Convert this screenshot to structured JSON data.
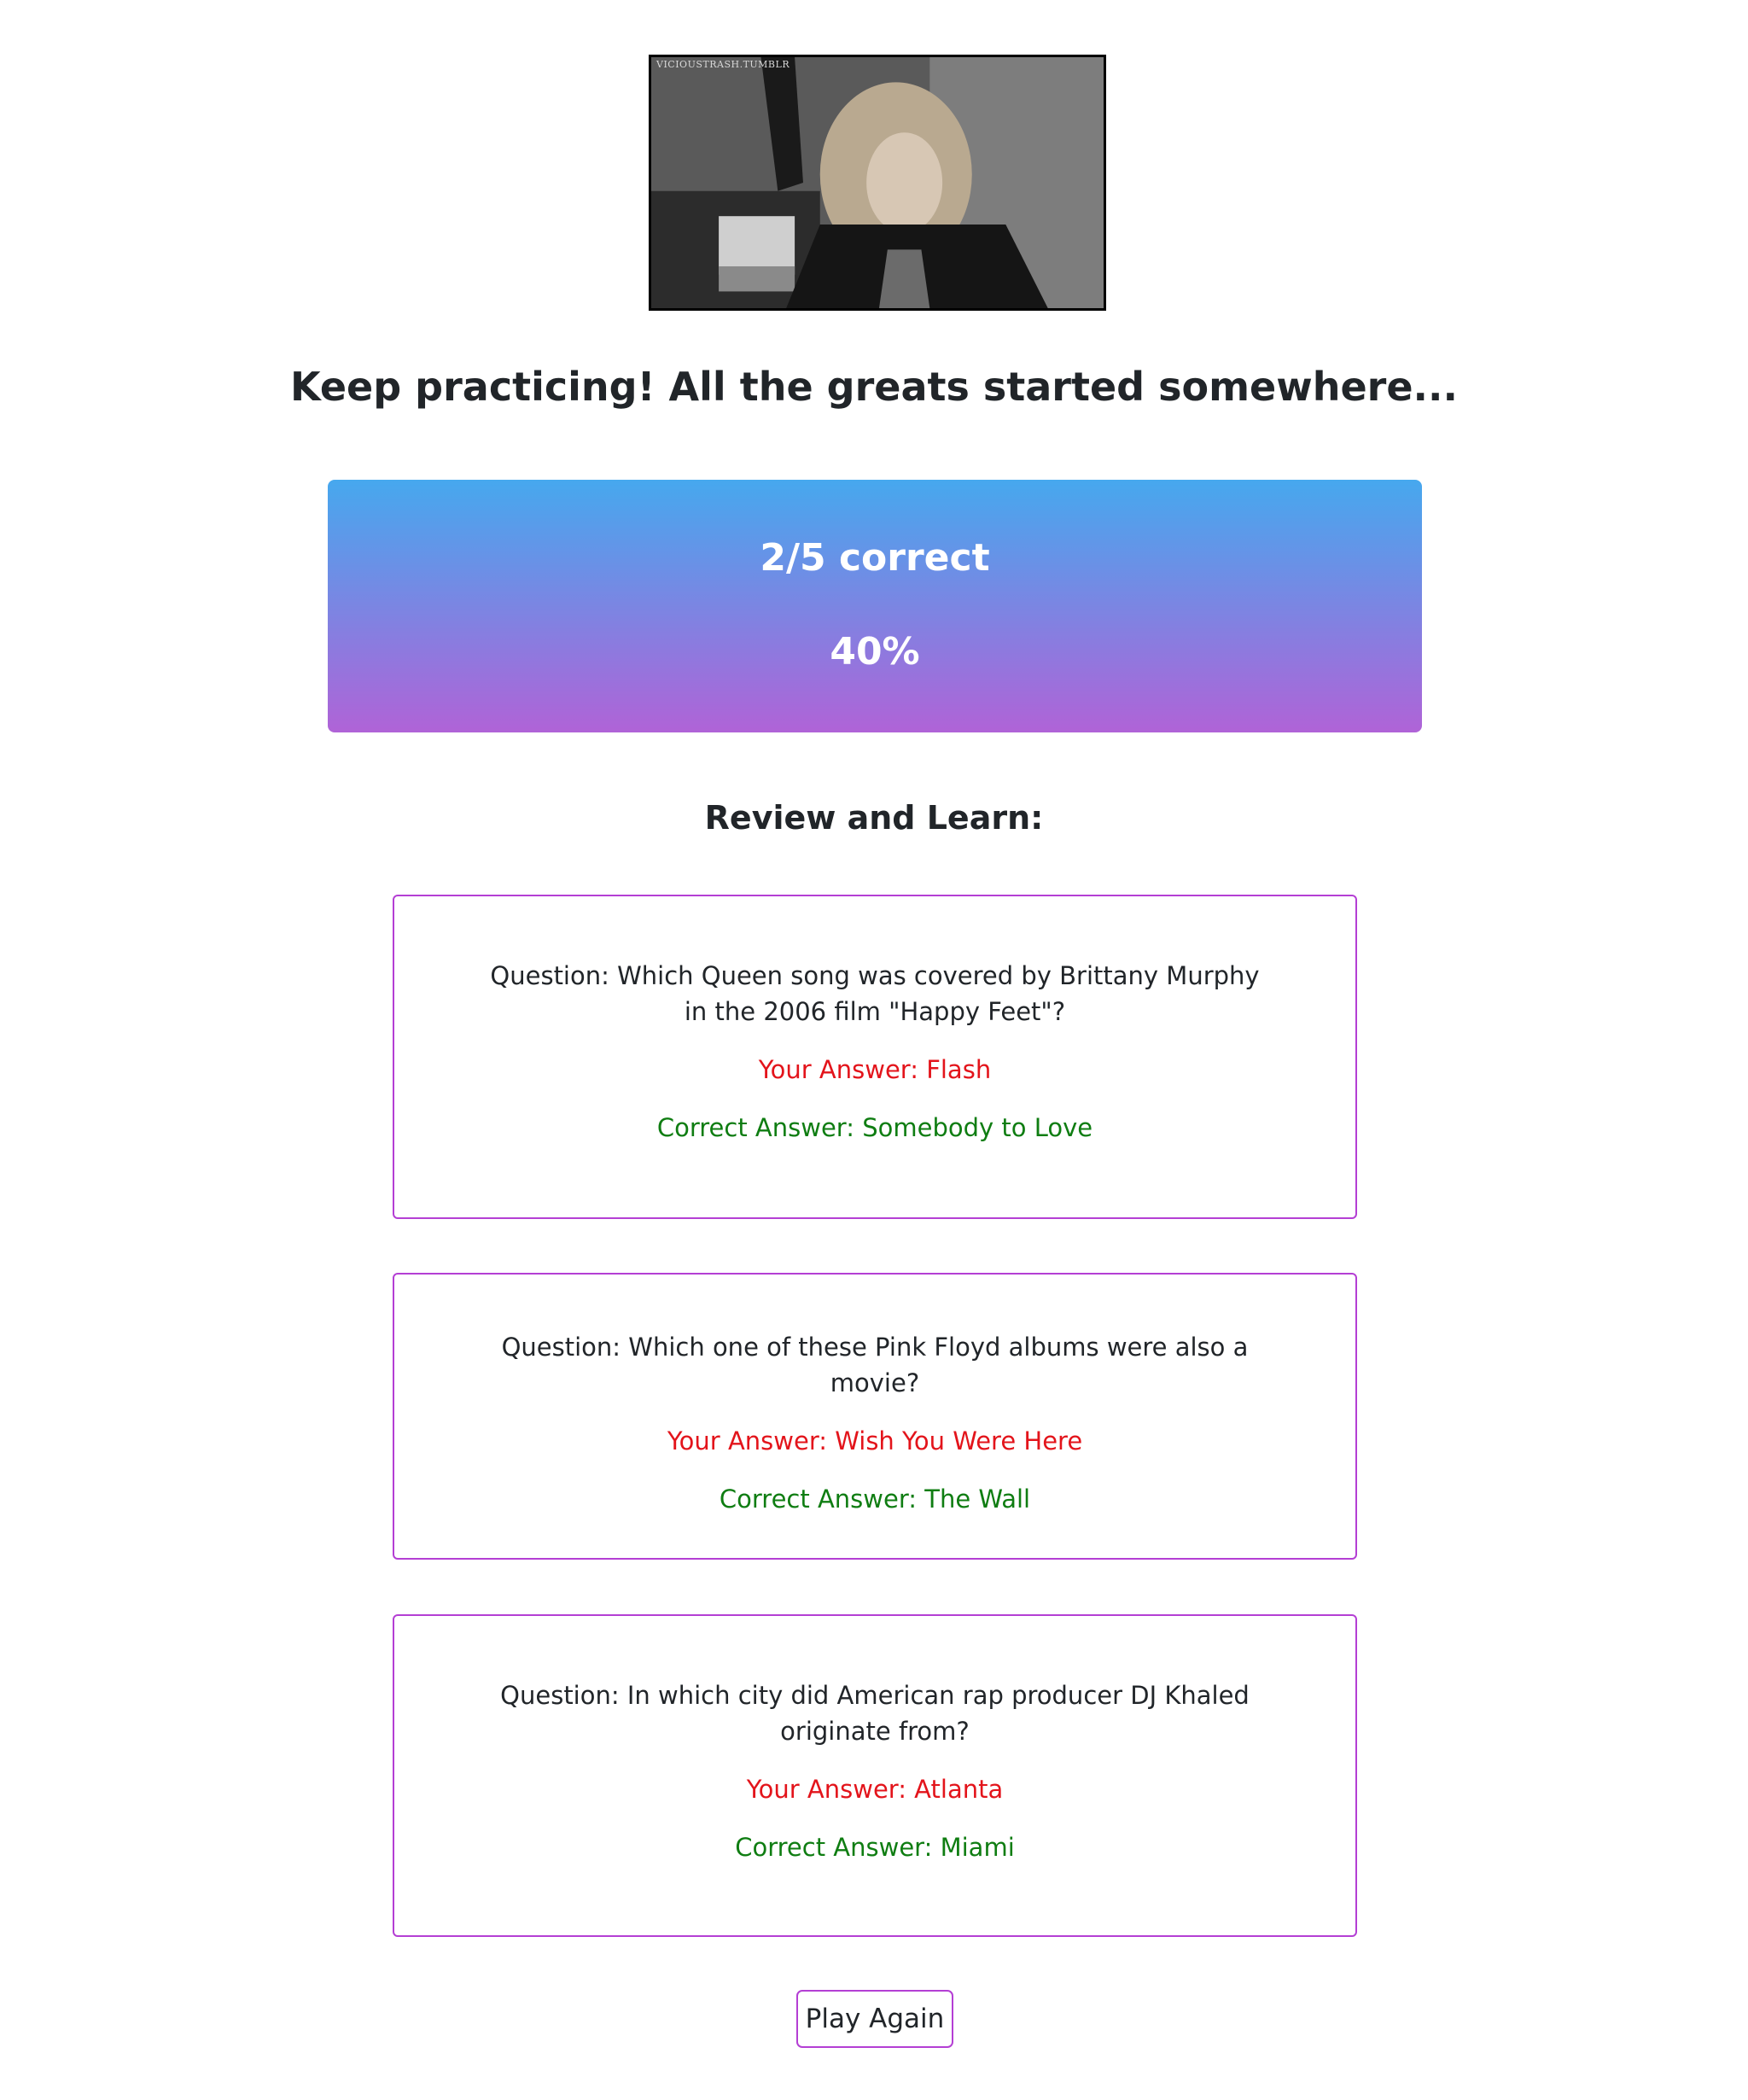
{
  "result_image": {
    "watermark": "VICIOUSTRASH.TUMBLR",
    "description_icon": "animated-gif"
  },
  "headline": "Keep practicing! All the greats started somewhere...",
  "score": {
    "fraction_label": "2/5 correct",
    "percent_label": "40%",
    "correct": 2,
    "total": 5,
    "percent": 40
  },
  "review": {
    "heading": "Review and Learn:",
    "items": [
      {
        "question": "Question: Which Queen song was covered by Brittany Murphy in the 2006 film \"Happy Feet\"?",
        "your_answer": "Your Answer: Flash",
        "correct_answer": "Correct Answer: Somebody to Love"
      },
      {
        "question": "Question: Which one of these Pink Floyd albums were also a movie?",
        "your_answer": "Your Answer: Wish You Were Here",
        "correct_answer": "Correct Answer: The Wall"
      },
      {
        "question": "Question: In which city did American rap producer DJ Khaled originate from?",
        "your_answer": "Your Answer: Atlanta",
        "correct_answer": "Correct Answer: Miami"
      }
    ]
  },
  "play_again_label": "Play Again",
  "colors": {
    "gradient_top": "#46a8ee",
    "gradient_bottom": "#b063d7",
    "card_border": "#b43fd4",
    "wrong": "#e3141b",
    "correct": "#0f7d12"
  }
}
